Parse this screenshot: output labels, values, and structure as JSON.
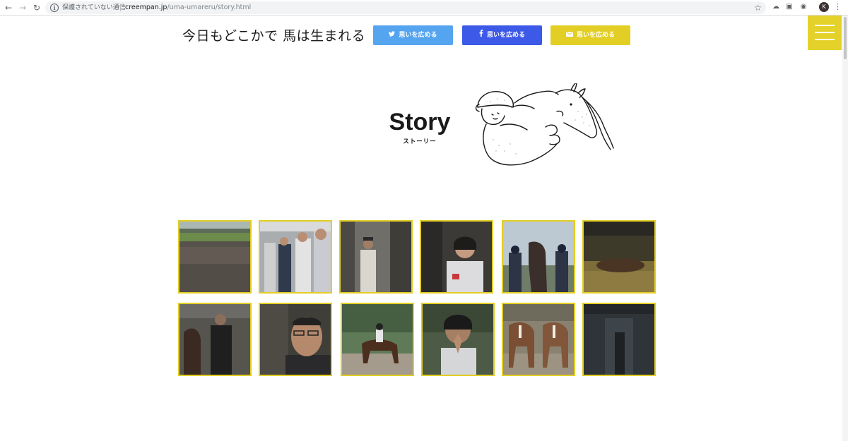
{
  "browser": {
    "security_label": "保護されていない通信",
    "url_host": "creempan.jp",
    "url_path": "/uma-umareru/story.html",
    "profile_initial": "K"
  },
  "header": {
    "site_title": "今日もどこかで 馬は生まれる",
    "share_buttons": [
      {
        "service": "twitter",
        "label": "思いを広める",
        "color": "#55a4f0",
        "icon": "twitter-icon"
      },
      {
        "service": "facebook",
        "label": "思いを広める",
        "color": "#3c59e7",
        "icon": "facebook-icon"
      },
      {
        "service": "mail",
        "label": "思いを広める",
        "color": "#e2ce24",
        "icon": "mail-icon"
      }
    ],
    "menu_color": "#e4d22a"
  },
  "story": {
    "title": "Story",
    "subtitle": "ストーリー"
  },
  "gallery": {
    "accent": "#e2ce24",
    "items": [
      {
        "subject": "racecourse-crowd"
      },
      {
        "subject": "men-reading-papers"
      },
      {
        "subject": "stable-worker"
      },
      {
        "subject": "smiling-woman"
      },
      {
        "subject": "girls-with-horse"
      },
      {
        "subject": "horse-lying-in-straw"
      },
      {
        "subject": "men-leading-horse"
      },
      {
        "subject": "man-with-glasses"
      },
      {
        "subject": "rider-on-horse"
      },
      {
        "subject": "girl-praying"
      },
      {
        "subject": "horses-grazing"
      },
      {
        "subject": "dark-stable-corridor"
      }
    ]
  }
}
